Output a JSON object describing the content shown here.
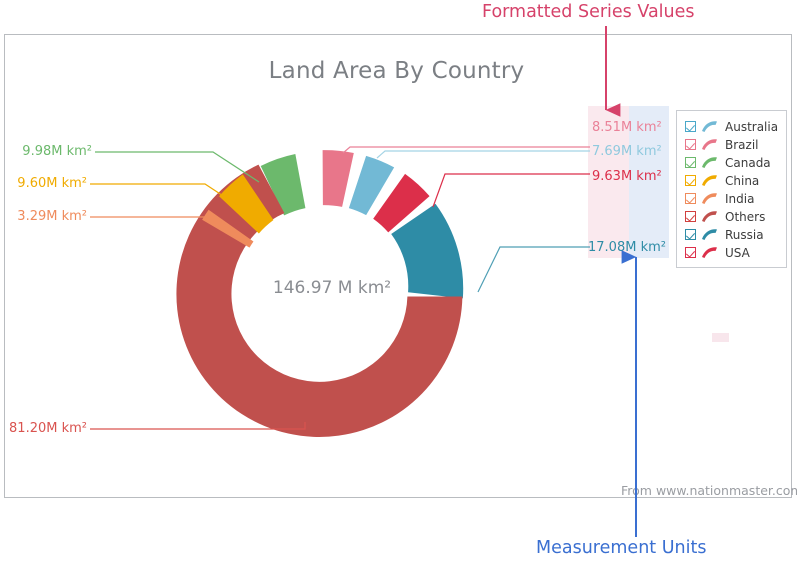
{
  "chart_data": {
    "type": "pie",
    "variant": "donut",
    "title": "Land Area By Country",
    "categories": [
      "Australia",
      "Brazil",
      "Canada",
      "China",
      "India",
      "Others",
      "Russia",
      "USA"
    ],
    "values": [
      7.69,
      8.51,
      9.98,
      9.6,
      3.29,
      81.2,
      17.08,
      9.63
    ],
    "value_labels": [
      "7.69M km²",
      "8.51M km²",
      "9.98M km²",
      "9.60M km²",
      "3.29M km²",
      "81.20M km²",
      "17.08M km²",
      "9.63M km²"
    ],
    "unit": "M km²",
    "total": 146.97,
    "total_label": "146.97 M km²",
    "colors": [
      "#72b9d5",
      "#e8768a",
      "#6cb96c",
      "#f0ab00",
      "#ef8b5c",
      "#c0504d",
      "#2e8ca6",
      "#dc2f4a"
    ],
    "legend_position": "right",
    "grid": false,
    "xlabel": "",
    "ylabel": "",
    "source": "From www.nationmaster.com"
  },
  "chart": {
    "title": "Land Area By Country",
    "center_total": "146.97 M km²",
    "attribution": "From www.nationmaster.com"
  },
  "labels": {
    "canada": {
      "text": "9.98M km²",
      "color": "#6cb96c"
    },
    "china": {
      "text": "9.60M km²",
      "color": "#f0ab00"
    },
    "india": {
      "text": "3.29M km²",
      "color": "#ef8b5c"
    },
    "others": {
      "text": "81.20M km²",
      "color": "#d9534f"
    },
    "brazil": {
      "text": "8.51M km²",
      "color": "#ea8198"
    },
    "australia": {
      "text": "7.69M km²",
      "color": "#8fc9de"
    },
    "usa": {
      "text": "9.63M km²",
      "color": "#dc2f4a"
    },
    "russia": {
      "text": "17.08M km²",
      "color": "#2e8ca6"
    }
  },
  "legend": {
    "items": [
      {
        "label": "Australia",
        "color": "#72b9d5",
        "checked": true
      },
      {
        "label": "Brazil",
        "color": "#e8768a",
        "checked": true
      },
      {
        "label": "Canada",
        "color": "#6cb96c",
        "checked": true
      },
      {
        "label": "China",
        "color": "#f0ab00",
        "checked": true
      },
      {
        "label": "India",
        "color": "#ef8b5c",
        "checked": true
      },
      {
        "label": "Others",
        "color": "#c0504d",
        "checked": true
      },
      {
        "label": "Russia",
        "color": "#2e8ca6",
        "checked": true
      },
      {
        "label": "USA",
        "color": "#dc2f4a",
        "checked": true
      }
    ]
  },
  "annotations": {
    "top": {
      "text": "Formatted Series Values",
      "color": "#d6426a"
    },
    "bottom": {
      "text": "Measurement Units",
      "color": "#3a6fd1"
    }
  }
}
